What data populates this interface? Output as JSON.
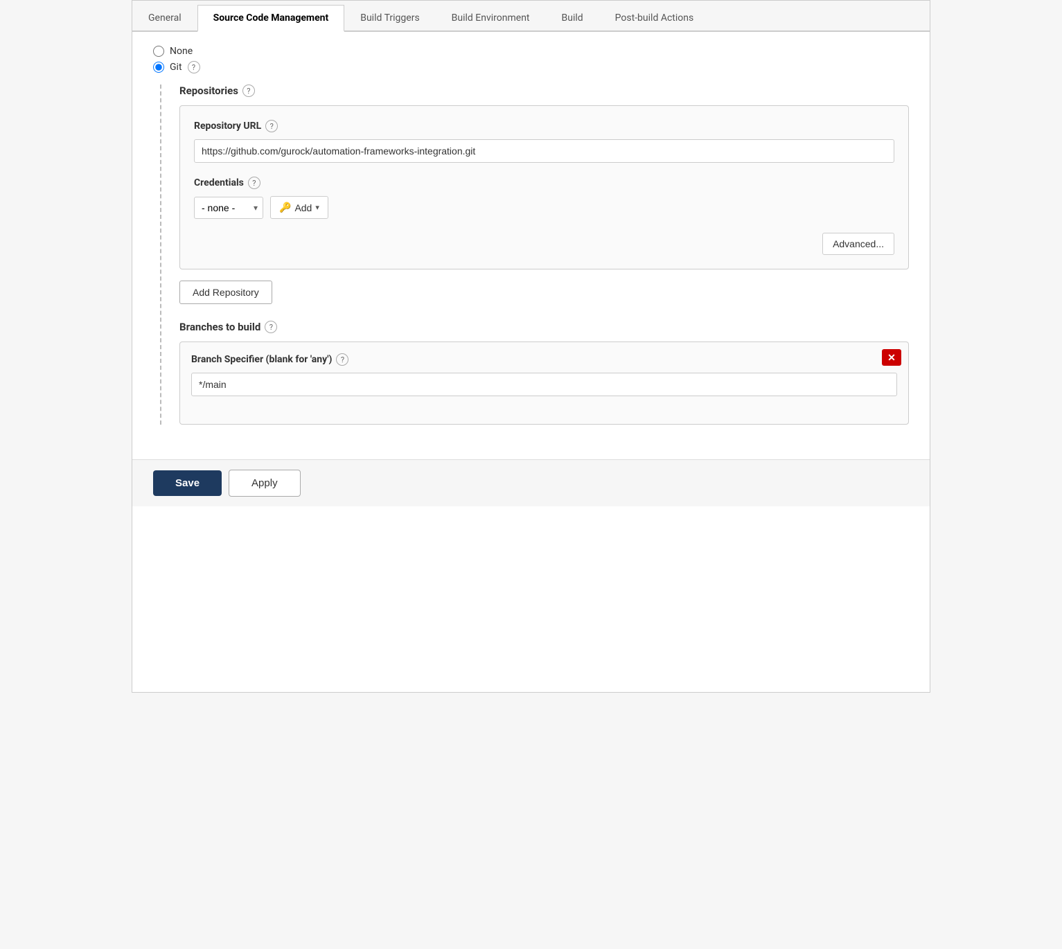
{
  "tabs": [
    {
      "id": "general",
      "label": "General",
      "active": false
    },
    {
      "id": "source-code-management",
      "label": "Source Code Management",
      "active": true
    },
    {
      "id": "build-triggers",
      "label": "Build Triggers",
      "active": false
    },
    {
      "id": "build-environment",
      "label": "Build Environment",
      "active": false
    },
    {
      "id": "build",
      "label": "Build",
      "active": false
    },
    {
      "id": "post-build-actions",
      "label": "Post-build Actions",
      "active": false
    }
  ],
  "scm": {
    "none_label": "None",
    "git_label": "Git",
    "repositories_label": "Repositories",
    "repository_url_label": "Repository URL",
    "repository_url_value": "https://github.com/gurock/automation-frameworks-integration.git",
    "credentials_label": "Credentials",
    "credentials_none_option": "- none -",
    "add_label": "Add",
    "advanced_label": "Advanced...",
    "add_repository_label": "Add Repository",
    "branches_label": "Branches to build",
    "branch_specifier_label": "Branch Specifier (blank for 'any')",
    "branch_specifier_value": "*/main"
  },
  "footer": {
    "save_label": "Save",
    "apply_label": "Apply"
  }
}
